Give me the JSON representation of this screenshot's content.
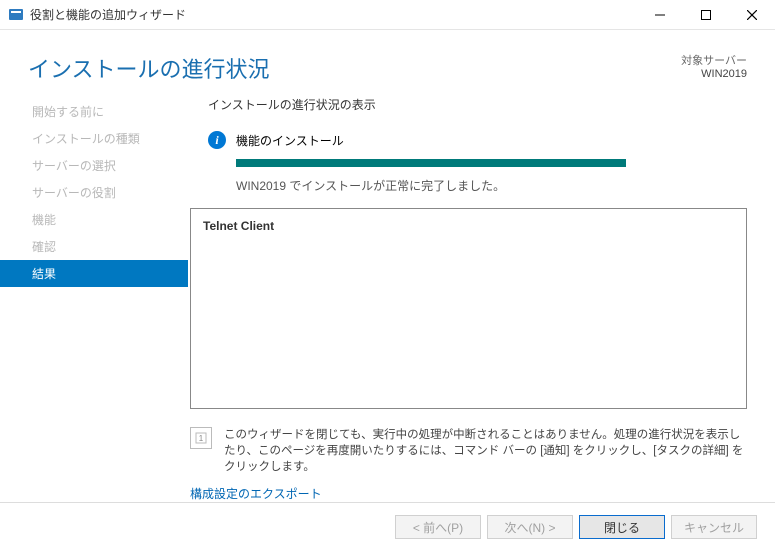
{
  "window": {
    "title": "役割と機能の追加ウィザード"
  },
  "header": {
    "page_title": "インストールの進行状況",
    "target_label": "対象サーバー",
    "target_name": "WIN2019"
  },
  "sidebar": {
    "items": [
      {
        "label": "開始する前に",
        "active": false
      },
      {
        "label": "インストールの種類",
        "active": false
      },
      {
        "label": "サーバーの選択",
        "active": false
      },
      {
        "label": "サーバーの役割",
        "active": false
      },
      {
        "label": "機能",
        "active": false
      },
      {
        "label": "確認",
        "active": false
      },
      {
        "label": "結果",
        "active": true
      }
    ]
  },
  "main": {
    "section_label": "インストールの進行状況の表示",
    "status_heading": "機能のインストール",
    "progress_percent": 100,
    "status_message": "WIN2019 でインストールが正常に完了しました。",
    "results": [
      "Telnet Client"
    ],
    "note_text": "このウィザードを閉じても、実行中の処理が中断されることはありません。処理の進行状況を表示したり、このページを再度開いたりするには、コマンド バーの [通知] をクリックし、[タスクの詳細] をクリックします。",
    "export_link": "構成設定のエクスポート"
  },
  "footer": {
    "prev": "< 前へ(P)",
    "next": "次へ(N) >",
    "close": "閉じる",
    "cancel": "キャンセル"
  }
}
